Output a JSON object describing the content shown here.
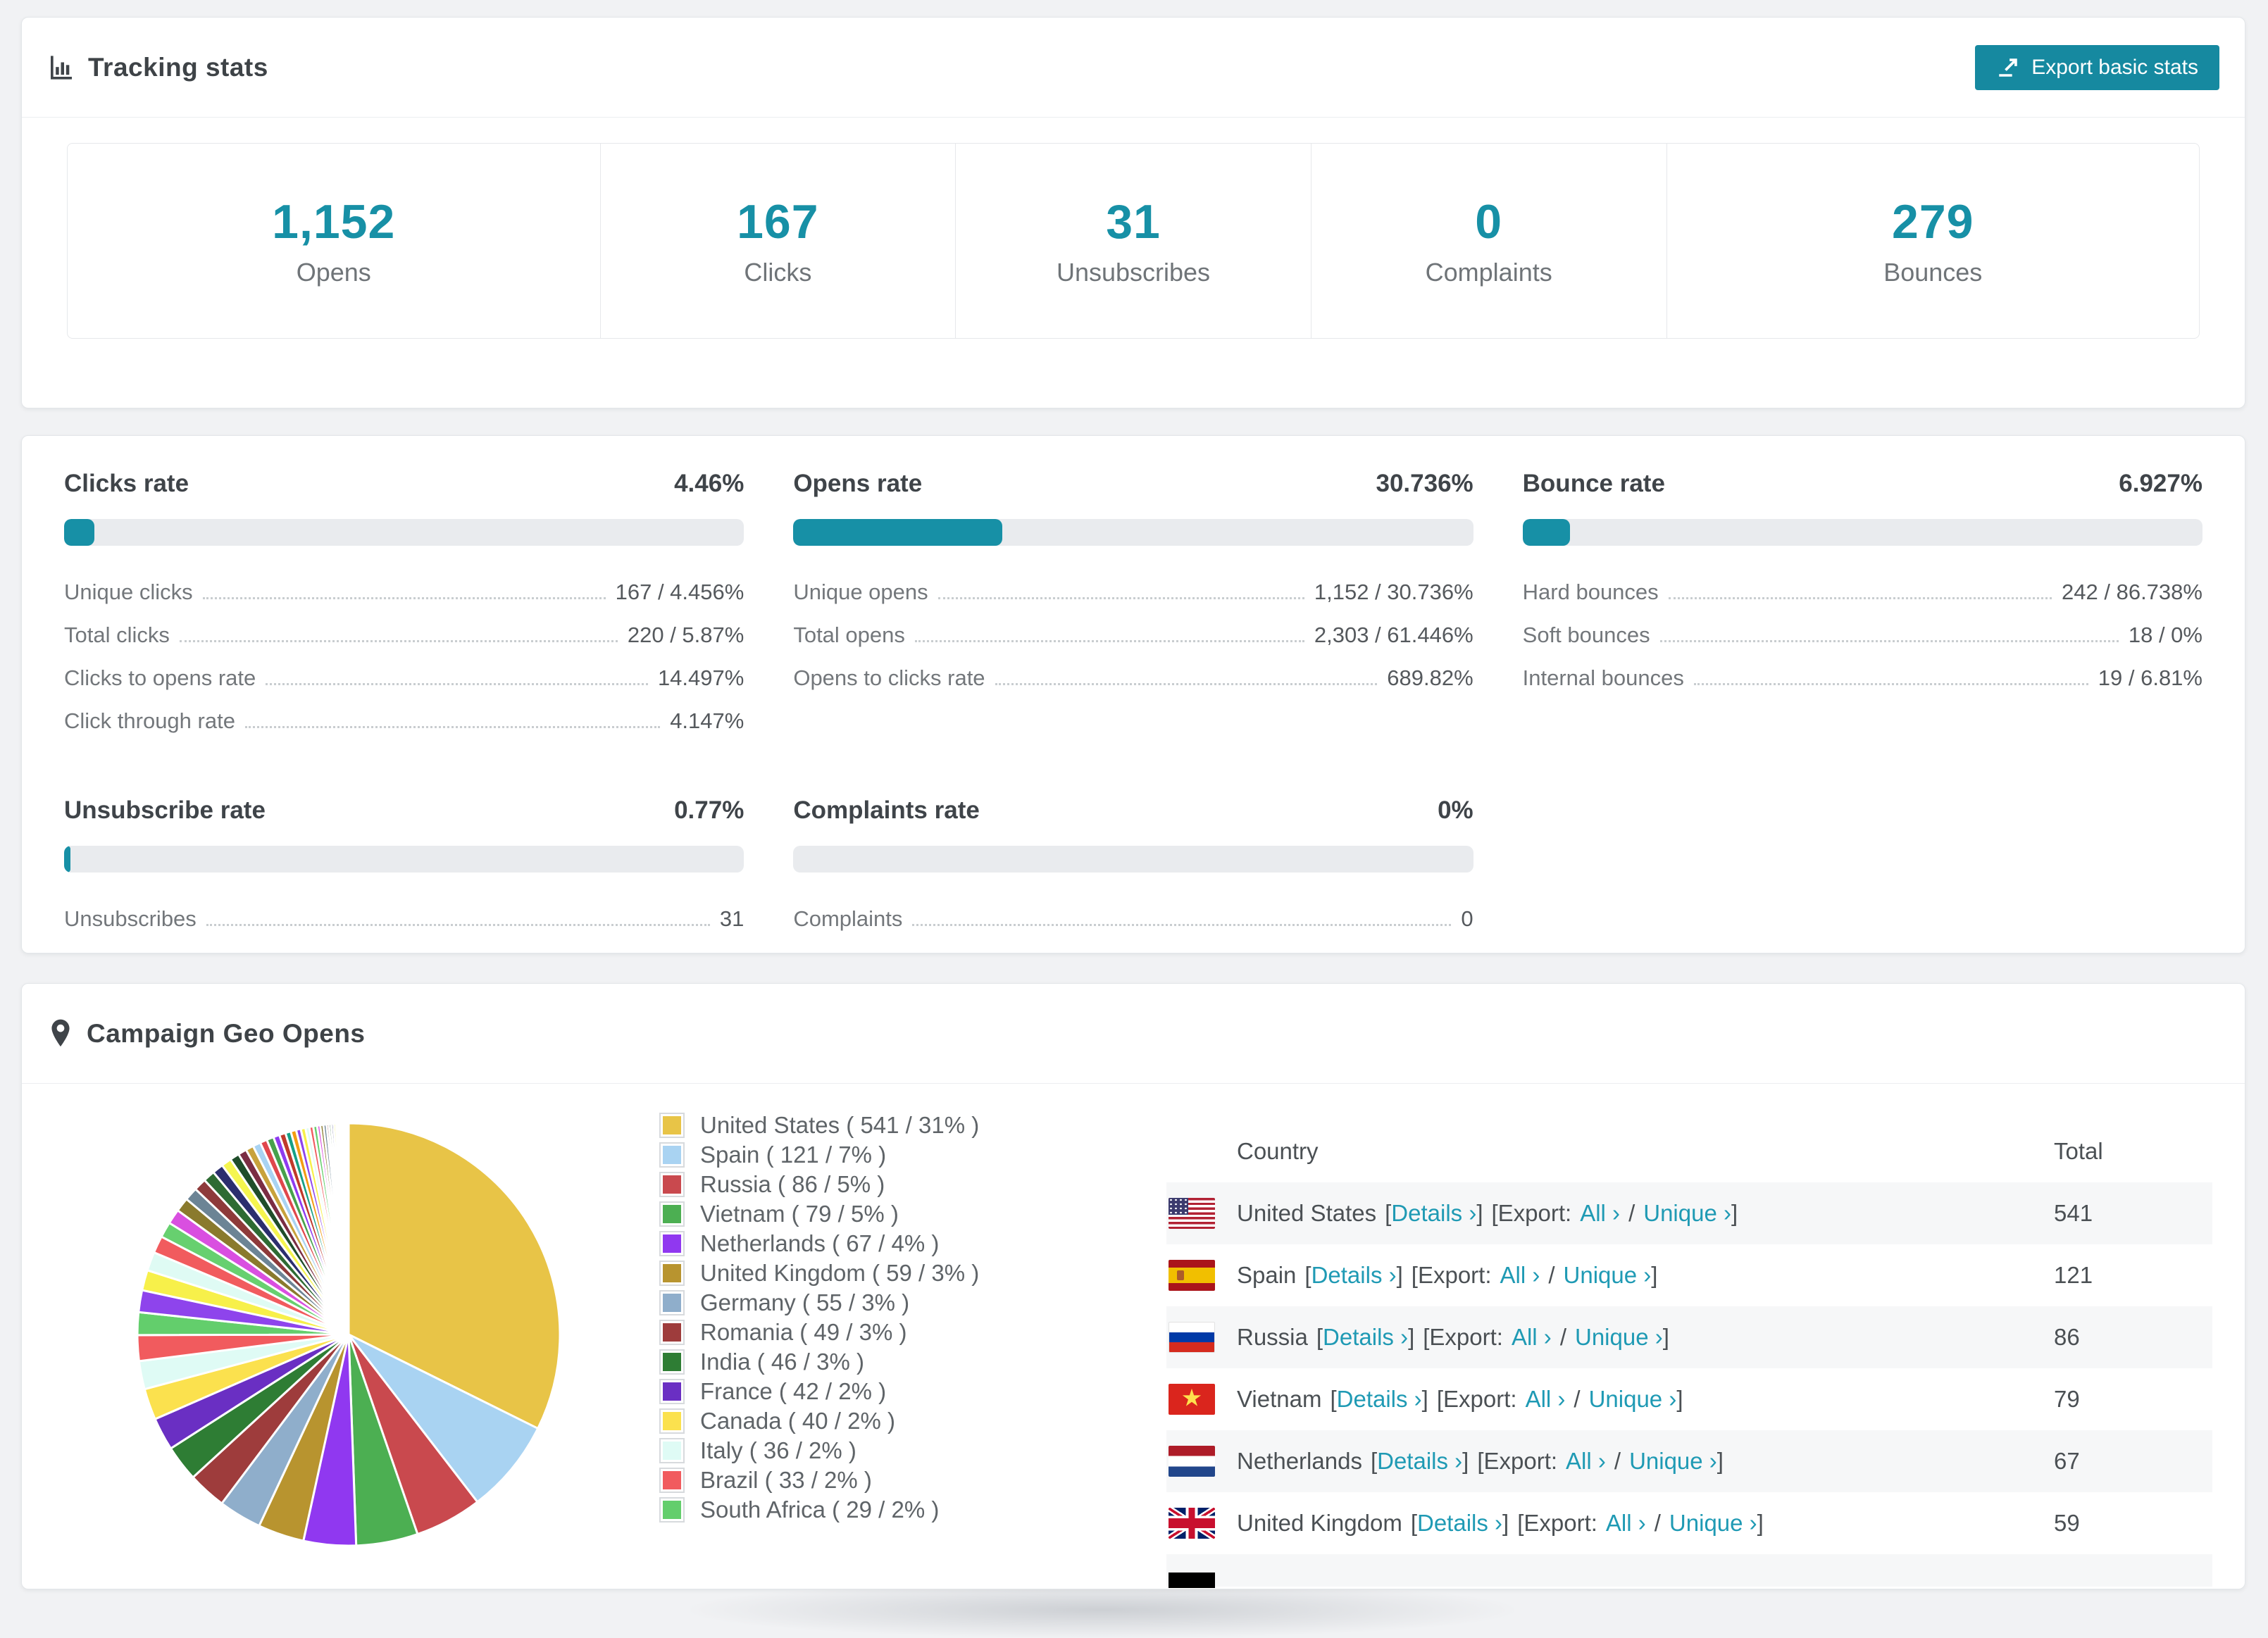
{
  "accent": "#1790a6",
  "tracking": {
    "title": "Tracking stats",
    "export_label": "Export basic stats"
  },
  "summary": [
    {
      "value": "1,152",
      "label": "Opens"
    },
    {
      "value": "167",
      "label": "Clicks"
    },
    {
      "value": "31",
      "label": "Unsubscribes"
    },
    {
      "value": "0",
      "label": "Complaints"
    },
    {
      "value": "279",
      "label": "Bounces"
    }
  ],
  "rates": [
    {
      "title": "Clicks rate",
      "value": "4.46%",
      "pct": 4.46,
      "rows": [
        {
          "label": "Unique clicks",
          "value": "167 / 4.456%"
        },
        {
          "label": "Total clicks",
          "value": "220 / 5.87%"
        },
        {
          "label": "Clicks to opens rate",
          "value": "14.497%"
        },
        {
          "label": "Click through rate",
          "value": "4.147%"
        }
      ]
    },
    {
      "title": "Opens rate",
      "value": "30.736%",
      "pct": 30.736,
      "rows": [
        {
          "label": "Unique opens",
          "value": "1,152 / 30.736%"
        },
        {
          "label": "Total opens",
          "value": "2,303 / 61.446%"
        },
        {
          "label": "Opens to clicks rate",
          "value": "689.82%"
        }
      ]
    },
    {
      "title": "Bounce rate",
      "value": "6.927%",
      "pct": 6.927,
      "rows": [
        {
          "label": "Hard bounces",
          "value": "242 / 86.738%"
        },
        {
          "label": "Soft bounces",
          "value": "18 / 0%"
        },
        {
          "label": "Internal bounces",
          "value": "19 / 6.81%"
        }
      ]
    },
    {
      "title": "Unsubscribe rate",
      "value": "0.77%",
      "pct": 0.77,
      "rows": [
        {
          "label": "Unsubscribes",
          "value": "31"
        }
      ]
    },
    {
      "title": "Complaints rate",
      "value": "0%",
      "pct": 0,
      "rows": [
        {
          "label": "Complaints",
          "value": "0"
        }
      ]
    }
  ],
  "geo": {
    "title": "Campaign Geo Opens",
    "chart_data": {
      "type": "pie",
      "title": "Campaign Geo Opens",
      "legend_position": "right",
      "series": [
        {
          "name": "United States",
          "value": 541,
          "pct": "31%",
          "color": "#E8C447"
        },
        {
          "name": "Spain",
          "value": 121,
          "pct": "7%",
          "color": "#A9D3F2"
        },
        {
          "name": "Russia",
          "value": 86,
          "pct": "5%",
          "color": "#C9494E"
        },
        {
          "name": "Vietnam",
          "value": 79,
          "pct": "5%",
          "color": "#4CAF52"
        },
        {
          "name": "Netherlands",
          "value": 67,
          "pct": "4%",
          "color": "#9038F0"
        },
        {
          "name": "United Kingdom",
          "value": 59,
          "pct": "3%",
          "color": "#B8942F"
        },
        {
          "name": "Germany",
          "value": 55,
          "pct": "3%",
          "color": "#8FAECB"
        },
        {
          "name": "Romania",
          "value": 49,
          "pct": "3%",
          "color": "#9E3C3C"
        },
        {
          "name": "India",
          "value": 46,
          "pct": "3%",
          "color": "#2E7D34"
        },
        {
          "name": "France",
          "value": 42,
          "pct": "2%",
          "color": "#6A2FC3"
        },
        {
          "name": "Canada",
          "value": 40,
          "pct": "2%",
          "color": "#FBE14E"
        },
        {
          "name": "Italy",
          "value": 36,
          "pct": "2%",
          "color": "#DFFBF5"
        },
        {
          "name": "Brazil",
          "value": 33,
          "pct": "2%",
          "color": "#F15B5E"
        },
        {
          "name": "South Africa",
          "value": 29,
          "pct": "2%",
          "color": "#63CE6C"
        }
      ],
      "others_values": [
        28,
        26,
        24,
        22,
        20,
        19,
        18,
        17,
        16,
        15,
        14,
        13,
        12,
        11,
        10,
        10,
        9,
        9,
        8,
        8,
        7,
        7,
        6,
        6,
        5,
        5,
        5,
        4,
        4,
        4,
        3,
        3,
        3,
        3,
        2,
        2,
        2,
        2,
        2,
        1,
        1,
        1,
        1,
        1,
        1
      ],
      "others_palette": [
        "#8E44EC",
        "#F7F04A",
        "#DFFBF4",
        "#F15B5E",
        "#67D06F",
        "#D94FE0",
        "#8A7A2D",
        "#6C8495",
        "#8E3A3A",
        "#2E6B33",
        "#2B2E6E",
        "#F5F54F",
        "#1F4D2A",
        "#7B2D43",
        "#C8A23B",
        "#A9D3F2",
        "#E0474C",
        "#47A14C",
        "#8E3BF0",
        "#C0392B",
        "#16A085",
        "#F39C12"
      ]
    },
    "legend": [
      "United States ( 541 / 31% )",
      "Spain ( 121 / 7% )",
      "Russia ( 86 / 5% )",
      "Vietnam ( 79 / 5% )",
      "Netherlands ( 67 / 4% )",
      "United Kingdom ( 59 / 3% )",
      "Germany ( 55 / 3% )",
      "Romania ( 49 / 3% )",
      "India ( 46 / 3% )",
      "France ( 42 / 2% )",
      "Canada ( 40 / 2% )",
      "Italy ( 36 / 2% )",
      "Brazil ( 33 / 2% )",
      "South Africa ( 29 / 2% )"
    ],
    "table": {
      "columns": [
        "Country",
        "Total"
      ],
      "labels": {
        "lb": "[",
        "rb": "]",
        "details": "Details ›",
        "export": "Export:",
        "all": "All ›",
        "slash": "/",
        "unique": "Unique ›"
      },
      "rows": [
        {
          "flag": "us",
          "name": "United States",
          "total": "541"
        },
        {
          "flag": "es",
          "name": "Spain",
          "total": "121"
        },
        {
          "flag": "ru",
          "name": "Russia",
          "total": "86"
        },
        {
          "flag": "vn",
          "name": "Vietnam",
          "total": "79"
        },
        {
          "flag": "nl",
          "name": "Netherlands",
          "total": "67"
        },
        {
          "flag": "gb",
          "name": "United Kingdom",
          "total": "59"
        }
      ]
    }
  }
}
